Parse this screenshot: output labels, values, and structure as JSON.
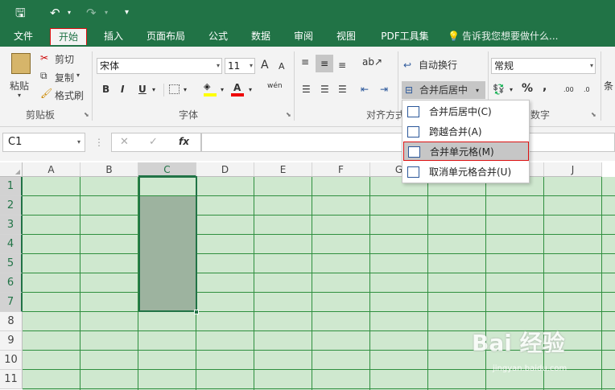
{
  "quick_access": {
    "save_icon": "save-icon",
    "undo_icon": "undo-icon",
    "redo_icon": "redo-icon",
    "customize_icon": "customize-qat-icon"
  },
  "tabs": [
    "文件",
    "开始",
    "插入",
    "页面布局",
    "公式",
    "数据",
    "审阅",
    "视图",
    "PDF工具集"
  ],
  "active_tab": "开始",
  "tell_me": "告诉我您想要做什么...",
  "clipboard": {
    "paste": "粘贴",
    "cut": "剪切",
    "copy": "复制",
    "format_painter": "格式刷",
    "group": "剪贴板"
  },
  "font": {
    "name": "宋体",
    "size": "11",
    "bold": "B",
    "italic": "I",
    "underline": "U",
    "grow": "A",
    "shrink": "A",
    "font_color": "A",
    "phonetic": "wén",
    "group": "字体"
  },
  "alignment": {
    "wrap": "自动换行",
    "merge": "合并后居中",
    "group": "对齐方式"
  },
  "number": {
    "format": "常规",
    "percent": "%",
    "comma": ",",
    "group": "数字",
    "inc_decimal": ".00",
    "dec_decimal": ".0"
  },
  "styles_partial": "条",
  "name_box": "C1",
  "formula_bar": {
    "cancel": "✕",
    "enter": "✓",
    "fx": "fx",
    "value": ""
  },
  "columns": [
    "A",
    "B",
    "C",
    "D",
    "E",
    "F",
    "G",
    "H",
    "I",
    "J"
  ],
  "rows": [
    "1",
    "2",
    "3",
    "4",
    "5",
    "6",
    "7",
    "8",
    "9",
    "10",
    "11"
  ],
  "merge_menu": [
    {
      "label": "合并后居中(C)",
      "highlighted": false
    },
    {
      "label": "跨越合并(A)",
      "highlighted": false
    },
    {
      "label": "合并单元格(M)",
      "highlighted": true
    },
    {
      "label": "取消单元格合并(U)",
      "highlighted": false
    }
  ],
  "watermark": {
    "text": "Bai  经验",
    "sub": "jingyan.baidu.com"
  },
  "colors": {
    "accent": "#217346",
    "cell_bg": "#cfe8cf",
    "selection": "#9db39f",
    "highlight_border": "#dd1111"
  }
}
